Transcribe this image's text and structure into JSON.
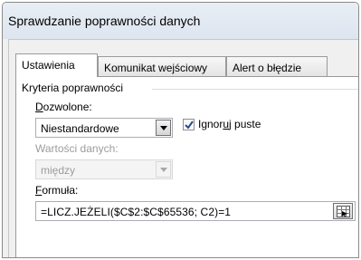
{
  "window": {
    "title": "Sprawdzanie poprawności danych"
  },
  "tabs": [
    {
      "label": "Ustawienia",
      "active": true
    },
    {
      "label": "Komunikat wejściowy",
      "active": false
    },
    {
      "label": "Alert o błędzie",
      "active": false
    }
  ],
  "criteria": {
    "group_label": "Kryteria poprawności",
    "allow": {
      "label_accel": "D",
      "label_rest": "ozwolone:",
      "value": "Niestandardowe"
    },
    "ignore_blank": {
      "label_pre": "Ignor",
      "label_accel": "u",
      "label_post": "j puste",
      "checked": true
    },
    "data": {
      "label": "Wartości danych:",
      "value": "między",
      "enabled": false
    },
    "formula": {
      "label_accel": "F",
      "label_rest": "ormuła:",
      "value": "=LICZ.JEŻELI($C$2:$C$65536; C2)=1"
    }
  },
  "icons": {
    "dropdown": "chevron-down-icon",
    "checkbox": "checkmark-icon",
    "range_picker": "range-select-icon"
  },
  "colors": {
    "check": "#2b4a8a",
    "title_bar": "#dde5ef"
  }
}
